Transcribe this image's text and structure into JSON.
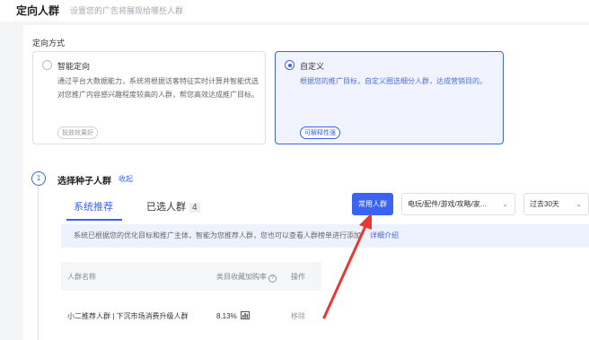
{
  "header": {
    "title": "定向人群",
    "subtitle": "设置您的广告将展现给哪些人群"
  },
  "targeting": {
    "label": "定向方式",
    "options": [
      {
        "title": "智能定向",
        "desc": "通过平台大数据能力，系统将根据访客特征实时计算并智能优选对您推广内容感兴趣程度较高的人群，帮您高效达成推广目标。",
        "tag": "投放效果好",
        "selected": false
      },
      {
        "title": "自定义",
        "desc": "根据您的推广目标，自定义圈选细分人群，达成营销目的。",
        "tag": "可解释性强",
        "selected": true
      }
    ]
  },
  "step": {
    "number": "1",
    "title": "选择种子人群",
    "collapse": "收起"
  },
  "tabs": {
    "recommended": "系统推荐",
    "selected": "已选人群",
    "selected_count": "4"
  },
  "toolbar": {
    "common_button": "常用人群",
    "category_select": "电玩/配件/游戏/攻略/家...",
    "time_select": "过去30天"
  },
  "notice": {
    "text": "系统已根据您的优化目标和推广主体，智能为您推荐人群，您也可以查看人群榜单进行添加",
    "more": "详细介绍"
  },
  "table": {
    "headers": [
      "人群名称",
      "类目收藏加购率",
      "操作"
    ],
    "rows": [
      {
        "name": "小二推荐人群 | 下沉市场消费升级人群",
        "rate": "8.13%",
        "action": "移除"
      }
    ]
  },
  "colors": {
    "primary": "#3a63f2",
    "annotation_arrow": "#e53935"
  }
}
